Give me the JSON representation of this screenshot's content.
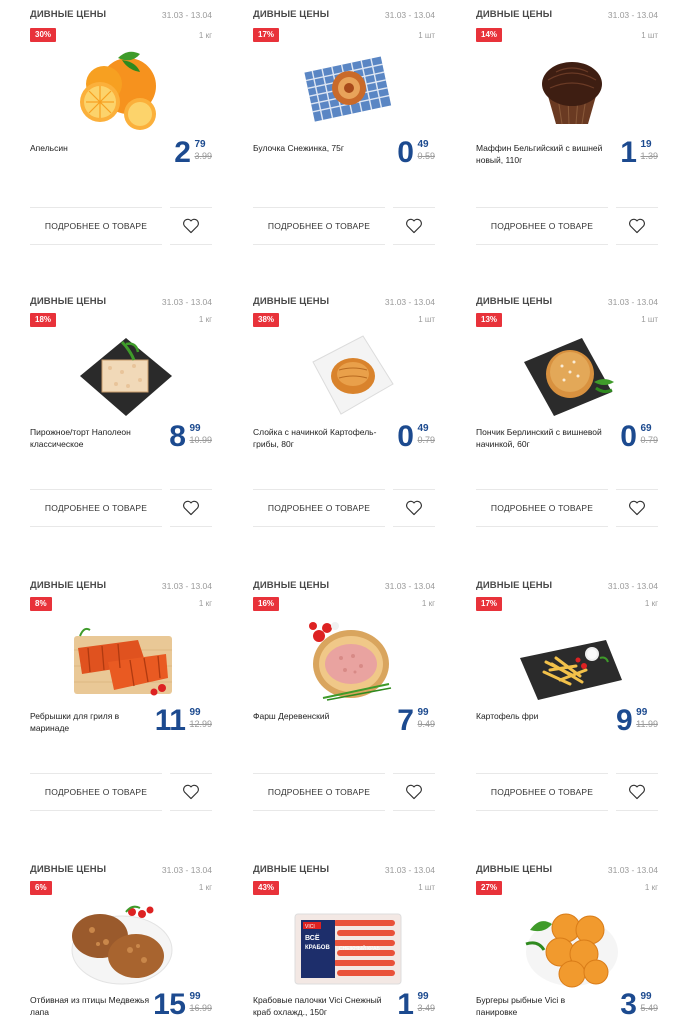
{
  "products": [
    {
      "brand": "ДИВНЫЕ ЦЕНЫ",
      "dates": "31.03 - 13.04",
      "badge": "30%",
      "unit": "1 кг",
      "name": "Апельсин",
      "price_int": "2",
      "price_cents": "79",
      "old_price": "3.99",
      "more": "ПОДРОБНЕЕ О ТОВАРЕ",
      "image": "orange"
    },
    {
      "brand": "ДИВНЫЕ ЦЕНЫ",
      "dates": "31.03 - 13.04",
      "badge": "17%",
      "unit": "1 шт",
      "name": "Булочка Снежинка, 75г",
      "price_int": "0",
      "price_cents": "49",
      "old_price": "0.59",
      "more": "ПОДРОБНЕЕ О ТОВАРЕ",
      "image": "bun"
    },
    {
      "brand": "ДИВНЫЕ ЦЕНЫ",
      "dates": "31.03 - 13.04",
      "badge": "14%",
      "unit": "1 шт",
      "name": "Маффин Бельгийский с вишней новый, 110г",
      "price_int": "1",
      "price_cents": "19",
      "old_price": "1.39",
      "more": "ПОДРОБНЕЕ О ТОВАРЕ",
      "image": "muffin"
    },
    {
      "brand": "ДИВНЫЕ ЦЕНЫ",
      "dates": "31.03 - 13.04",
      "badge": "18%",
      "unit": "1 кг",
      "name": "Пирожное/торт Наполеон классическое",
      "price_int": "8",
      "price_cents": "99",
      "old_price": "10.99",
      "more": "ПОДРОБНЕЕ О ТОВАРЕ",
      "image": "napoleon"
    },
    {
      "brand": "ДИВНЫЕ ЦЕНЫ",
      "dates": "31.03 - 13.04",
      "badge": "38%",
      "unit": "1 шт",
      "name": "Слойка с начинкой Картофель-грибы, 80г",
      "price_int": "0",
      "price_cents": "49",
      "old_price": "0.79",
      "more": "ПОДРОБНЕЕ О ТОВАРЕ",
      "image": "puff"
    },
    {
      "brand": "ДИВНЫЕ ЦЕНЫ",
      "dates": "31.03 - 13.04",
      "badge": "13%",
      "unit": "1 шт",
      "name": "Пончик Берлинский с вишневой начинкой, 60г",
      "price_int": "0",
      "price_cents": "69",
      "old_price": "0.79",
      "more": "ПОДРОБНЕЕ О ТОВАРЕ",
      "image": "donut"
    },
    {
      "brand": "ДИВНЫЕ ЦЕНЫ",
      "dates": "31.03 - 13.04",
      "badge": "8%",
      "unit": "1 кг",
      "name": "Ребрышки для гриля в маринаде",
      "price_int": "11",
      "price_cents": "99",
      "old_price": "12.99",
      "more": "ПОДРОБНЕЕ О ТОВАРЕ",
      "image": "ribs"
    },
    {
      "brand": "ДИВНЫЕ ЦЕНЫ",
      "dates": "31.03 - 13.04",
      "badge": "16%",
      "unit": "1 кг",
      "name": "Фарш Деревенский",
      "price_int": "7",
      "price_cents": "99",
      "old_price": "9.49",
      "more": "ПОДРОБНЕЕ О ТОВАРЕ",
      "image": "mince"
    },
    {
      "brand": "ДИВНЫЕ ЦЕНЫ",
      "dates": "31.03 - 13.04",
      "badge": "17%",
      "unit": "1 кг",
      "name": "Картофель фри",
      "price_int": "9",
      "price_cents": "99",
      "old_price": "11.99",
      "more": "ПОДРОБНЕЕ О ТОВАРЕ",
      "image": "fries"
    },
    {
      "brand": "ДИВНЫЕ ЦЕНЫ",
      "dates": "31.03 - 13.04",
      "badge": "6%",
      "unit": "1 кг",
      "name": "Отбивная из птицы Медвежья лапа",
      "price_int": "15",
      "price_cents": "99",
      "old_price": "16.99",
      "more": "ПОДРОБНЕЕ О ТОВАРЕ",
      "image": "chop"
    },
    {
      "brand": "ДИВНЫЕ ЦЕНЫ",
      "dates": "31.03 - 13.04",
      "badge": "43%",
      "unit": "1 шт",
      "name": "Крабовые палочки Vici Снежный краб охлажд., 150г",
      "price_int": "1",
      "price_cents": "99",
      "old_price": "3.49",
      "more": "ПОДРОБНЕЕ О ТОВАРЕ",
      "image": "crab"
    },
    {
      "brand": "ДИВНЫЕ ЦЕНЫ",
      "dates": "31.03 - 13.04",
      "badge": "27%",
      "unit": "1 кг",
      "name": "Бургеры рыбные Vici в панировке",
      "price_int": "3",
      "price_cents": "99",
      "old_price": "5.49",
      "more": "ПОДРОБНЕЕ О ТОВАРЕ",
      "image": "burgers"
    }
  ],
  "crab_pack": {
    "logo": "VICI",
    "line1": "ВСЁ",
    "line2": "КРАБОВ",
    "label": "СНЕЖНЫЙ КРАБ"
  },
  "colors": {
    "accent": "#1c4a8f",
    "badge": "#e8323a",
    "muted": "#9a9a9a"
  }
}
